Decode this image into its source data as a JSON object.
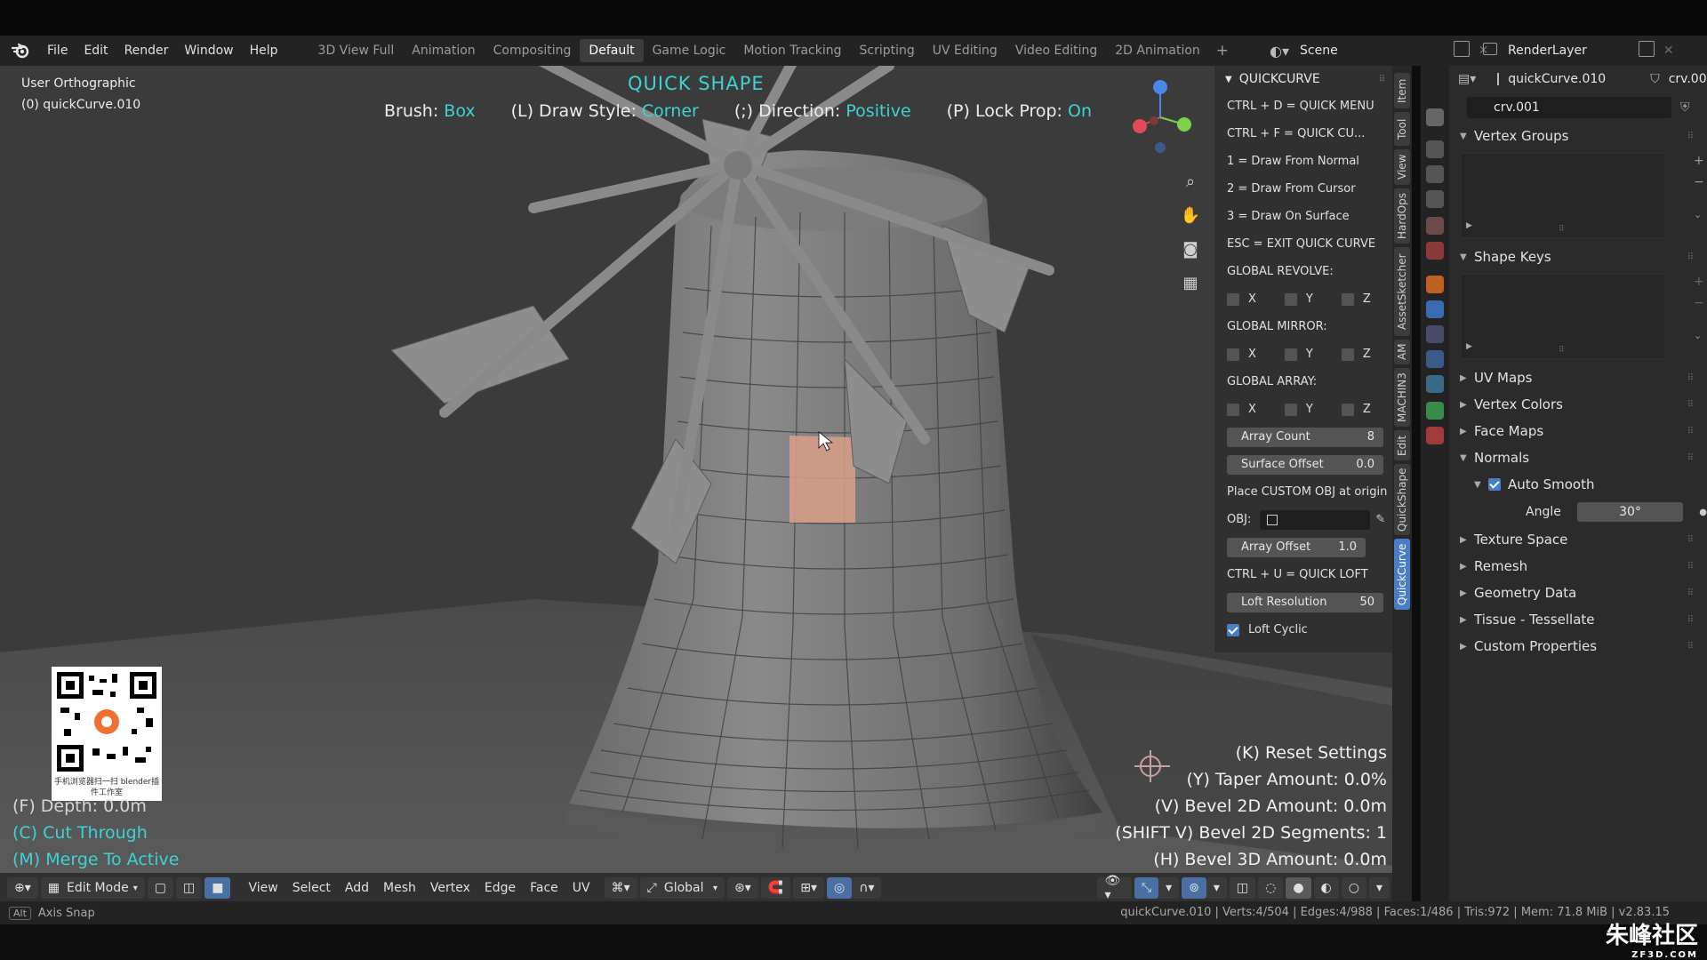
{
  "menubar": {
    "menus": [
      "File",
      "Edit",
      "Render",
      "Window",
      "Help"
    ],
    "workspaces": [
      "3D View Full",
      "Animation",
      "Compositing",
      "Default",
      "Game Logic",
      "Motion Tracking",
      "Scripting",
      "UV Editing",
      "Video Editing",
      "2D Animation"
    ],
    "active_workspace": "Default",
    "scene": "Scene",
    "render_layer": "RenderLayer"
  },
  "viewport": {
    "view_name": "User Orthographic",
    "object_name": "(0) quickCurve.010",
    "title": "QUICK SHAPE",
    "brush_label": "Brush:",
    "brush_value": "Box",
    "draw_style_label": "(L) Draw Style:",
    "draw_style_value": "Corner",
    "direction_label": "(;) Direction:",
    "direction_value": "Positive",
    "lock_prop_label": "(P) Lock Prop:",
    "lock_prop_value": "On",
    "left_info": [
      "(F) Depth: 0.0m",
      "(C) Cut Through",
      "(M) Merge To Active"
    ],
    "right_info": [
      "(K) Reset Settings",
      "(Y) Taper Amount: 0.0%",
      "(V) Bevel 2D Amount: 0.0m",
      "(SHIFT V) Bevel 2D Segments: 1",
      "(H) Bevel 3D Amount: 0.0m"
    ],
    "qr_caption": "手机浏览器扫一扫 blender插件工作室"
  },
  "header": {
    "mode": "Edit Mode",
    "menus": [
      "View",
      "Select",
      "Add",
      "Mesh",
      "Vertex",
      "Edge",
      "Face",
      "UV"
    ],
    "transform": "Global"
  },
  "npanel": {
    "title": "QUICKCURVE",
    "lines": [
      "CTRL + D = QUICK MENU",
      "CTRL + F = QUICK CU...",
      "1 = Draw From Normal",
      "2 = Draw From Cursor",
      "3 = Draw On Surface",
      "ESC = EXIT QUICK CURVE"
    ],
    "global_revolve": "GLOBAL REVOLVE:",
    "global_mirror": "GLOBAL MIRROR:",
    "global_array": "GLOBAL ARRAY:",
    "axes": [
      "X",
      "Y",
      "Z"
    ],
    "array_count_label": "Array Count",
    "array_count_value": "8",
    "surface_offset_label": "Surface Offset",
    "surface_offset_value": "0.0",
    "place_custom": "Place CUSTOM OBJ at origin",
    "obj_label": "OBJ:",
    "array_offset_label": "Array Offset",
    "array_offset_value": "1.0",
    "quick_loft": "CTRL + U = QUICK LOFT",
    "loft_resolution_label": "Loft Resolution",
    "loft_resolution_value": "50",
    "loft_cyclic": "Loft Cyclic"
  },
  "vtabs": [
    "Item",
    "Tool",
    "View",
    "HardOps",
    "AssetSketcher",
    "AM",
    "MACHIN3",
    "Edit",
    "QuickShape",
    "QuickCurve"
  ],
  "active_vtab": "QuickCurve",
  "properties": {
    "object": "quickCurve.010",
    "data_name_top": "crv.001",
    "data_name": "crv.001",
    "sections": {
      "vertex_groups": "Vertex Groups",
      "shape_keys": "Shape Keys",
      "uv_maps": "UV Maps",
      "vertex_colors": "Vertex Colors",
      "face_maps": "Face Maps",
      "normals": "Normals",
      "auto_smooth": "Auto Smooth",
      "angle_label": "Angle",
      "angle_value": "30°",
      "texture_space": "Texture Space",
      "remesh": "Remesh",
      "geometry_data": "Geometry Data",
      "tissue": "Tissue - Tessellate",
      "custom_props": "Custom Properties"
    }
  },
  "status": {
    "left_key": "Alt",
    "left": "Axis Snap",
    "right": "quickCurve.010 | Verts:4/504 | Edges:4/988 | Faces:1/486 | Tris:972 | Mem: 71.8 MiB | v2.83.15"
  },
  "watermark": {
    "text": "朱峰社区",
    "sub": "ZF3D.COM"
  },
  "colors": {
    "accent_cyan": "#3ed2d2",
    "accent_green": "#33d9a0",
    "active_blue": "#4a7dc8",
    "selection_face": "#d9a08a"
  }
}
